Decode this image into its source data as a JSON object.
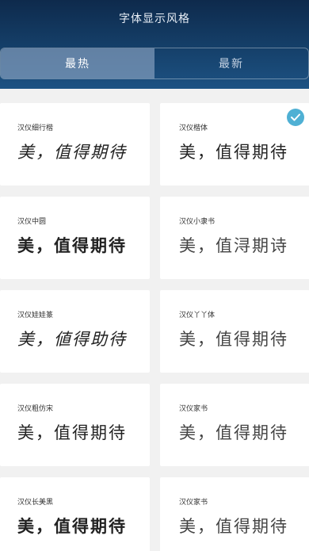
{
  "header": {
    "title": "字体显示风格",
    "tabs": [
      {
        "label": "最热",
        "active": true
      },
      {
        "label": "最新",
        "active": false
      }
    ]
  },
  "fonts": [
    {
      "name": "汉仪细行楷",
      "sample": "美，值得期待",
      "selected": false
    },
    {
      "name": "汉仪楷体",
      "sample": "美，值得期待",
      "selected": true
    },
    {
      "name": "汉仪中圆",
      "sample": "美，值得期待",
      "selected": false
    },
    {
      "name": "汉仪小隶书",
      "sample": "美，值浔期诗",
      "selected": false
    },
    {
      "name": "汉仪娃娃篆",
      "sample": "美，値得助待",
      "selected": false
    },
    {
      "name": "汉仪丫丫体",
      "sample": "美，值得期待",
      "selected": false
    },
    {
      "name": "汉仪粗仿宋",
      "sample": "美，值得期待",
      "selected": false
    },
    {
      "name": "汉仪家书",
      "sample": "美，值得期待",
      "selected": false
    },
    {
      "name": "汉仪长美黑",
      "sample": "美，值得期待",
      "selected": false
    },
    {
      "name": "汉仪家书",
      "sample": "美，值得期待",
      "selected": false
    }
  ],
  "colors": {
    "header_top": "#0e2a4c",
    "header_bottom": "#1d5283",
    "check_badge": "#4fb0d4",
    "background": "#f1f1f1"
  },
  "icons": {
    "selected_badge": "check-icon"
  }
}
